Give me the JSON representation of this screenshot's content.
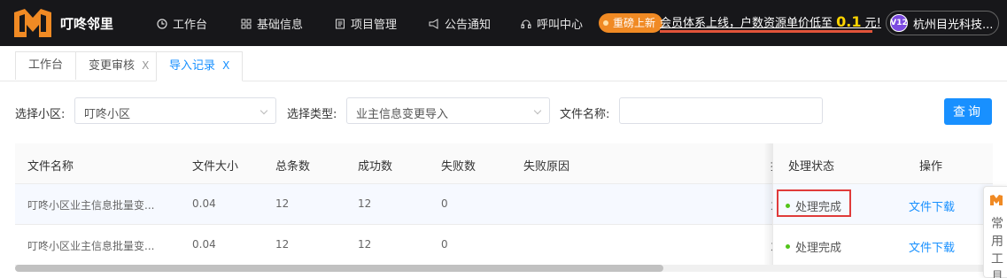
{
  "brand": {
    "name": "叮咚邻里"
  },
  "nav": [
    {
      "label": "工作台",
      "icon": "clock-icon"
    },
    {
      "label": "基础信息",
      "icon": "grid-icon"
    },
    {
      "label": "项目管理",
      "icon": "document-icon"
    },
    {
      "label": "公告通知",
      "icon": "megaphone-icon"
    },
    {
      "label": "呼叫中心",
      "icon": "headset-icon"
    }
  ],
  "promo": {
    "badge": "重磅上新",
    "text_before": "会员体系上线，户数资源单价低至",
    "price": "0.1",
    "text_after": "元!"
  },
  "user": {
    "level": "V12",
    "name": "杭州目光科技..."
  },
  "tabs": [
    {
      "label": "工作台",
      "closable": false
    },
    {
      "label": "变更审核",
      "closable": true
    },
    {
      "label": "导入记录",
      "closable": true,
      "active": true
    }
  ],
  "tab_close_glyph": "X",
  "filters": {
    "community_label": "选择小区:",
    "community_value": "叮咚小区",
    "type_label": "选择类型:",
    "type_value": "业主信息变更导入",
    "filename_label": "文件名称:",
    "filename_value": "",
    "query_button": "查询"
  },
  "table": {
    "columns": [
      "文件名称",
      "文件大小",
      "总条数",
      "成功数",
      "失败数",
      "失败原因",
      "处理状态",
      "操作"
    ],
    "hidden_col_fragment": "掉",
    "rows": [
      {
        "file_name": "叮咚小区业主信息批量变...",
        "file_size": "0.04",
        "total": "12",
        "success": "12",
        "failed": "0",
        "reason": "",
        "hidden_fragment": "力",
        "status": "处理完成",
        "action": "文件下载"
      },
      {
        "file_name": "叮咚小区业主信息批量变...",
        "file_size": "0.04",
        "total": "12",
        "success": "12",
        "failed": "0",
        "reason": "",
        "hidden_fragment": "力",
        "status": "处理完成",
        "action": "文件下载"
      }
    ]
  },
  "side_widget": {
    "label": "常用工具"
  },
  "colors": {
    "accent": "#1890ff",
    "topbar": "#17171a",
    "promo": "#f08a24",
    "success": "#52c41a",
    "highlight": "#e03b3b"
  }
}
